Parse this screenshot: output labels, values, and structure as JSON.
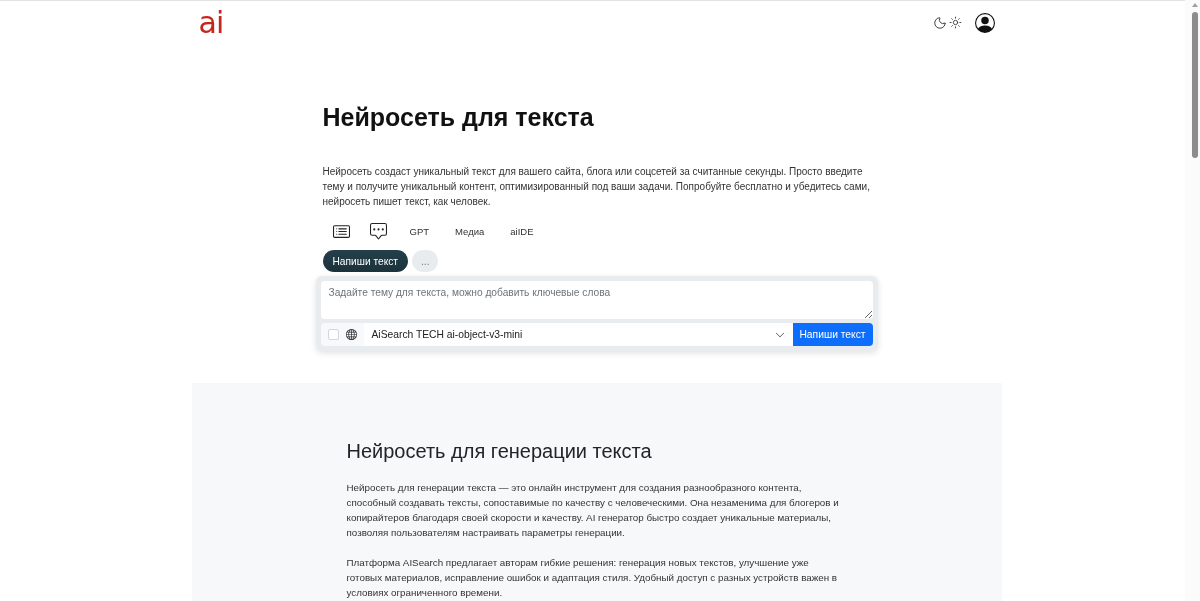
{
  "header": {
    "logo": "ai"
  },
  "hero": {
    "title": "Нейросеть для текста",
    "description": "Нейросеть создаст уникальный текст для вашего сайта, блога или соцсетей за считанные секунды. Просто введите тему и получите уникальный контент, оптимизированный под ваши задачи. Попробуйте бесплатно и убедитесь сами, нейросеть пишет текст, как человек."
  },
  "tabs": [
    {
      "label": "GPT"
    },
    {
      "label": "Медиа"
    },
    {
      "label": "aiIDE"
    }
  ],
  "modes": [
    {
      "label": "Напиши текст",
      "selected": true
    },
    {
      "label": "...",
      "selected": false
    }
  ],
  "prompt": {
    "placeholder": "Задайте тему для текста, можно добавить ключевые слова"
  },
  "options": {
    "checked": false
  },
  "model_select": {
    "value": "AiSearch TECH ai-object-v3-mini"
  },
  "submit_button": "Напиши текст",
  "article": {
    "heading": "Нейросеть для генерации текста",
    "paragraphs": [
      "Нейросеть для генерации текста — это онлайн инструмент для создания разнообразного контента, способный создавать тексты, сопоставимые по качеству с человеческими. Она незаменима для блогеров и копирайтеров благодаря своей скорости и качеству. AI генератор быстро создает уникальные материалы, позволяя пользователям настраивать параметры генерации.",
      "Платформа AISearch предлагает авторам гибкие решения: генерация новых текстов, улучшение уже готовых материалов, исправление ошибок и адаптация стиля. Удобный доступ с разных устройств важен в условиях ограниченного времени."
    ]
  }
}
